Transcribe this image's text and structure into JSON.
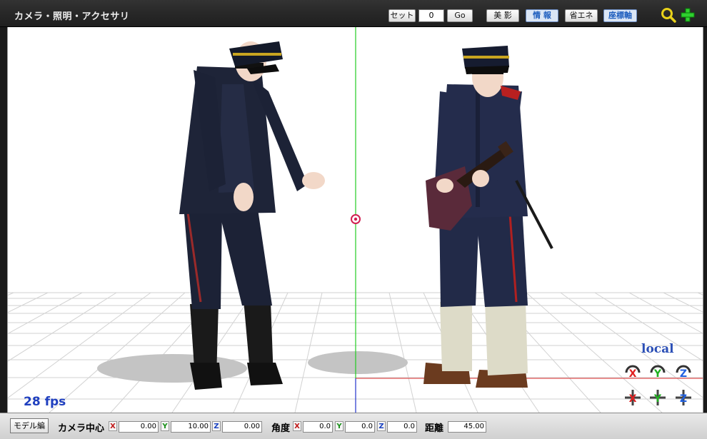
{
  "titlebar": {
    "title": "カメラ・照明・アクセサリ",
    "set_label": "セット",
    "frame_value": "0",
    "go_label": "Go",
    "bieiei_label": "美 影",
    "info_label": "情 報",
    "eco_label": "省エネ",
    "axis_label": "座標軸",
    "zoom_icon": "magnifier-icon",
    "move_icon": "green-cross-icon"
  },
  "viewport": {
    "fps": "28 fps",
    "local": "local",
    "colors": {
      "grid": "#cfcfcf",
      "y_axis": "#22cc22",
      "x_axis": "#e03030",
      "z_axis": "#2233cc"
    }
  },
  "bottombar": {
    "model_edit": "モデル編",
    "camera_center": "カメラ中心",
    "angle": "角度",
    "distance": "距離",
    "x": "X",
    "y": "Y",
    "z": "Z",
    "center_x": "0.00",
    "center_y": "10.00",
    "center_z": "0.00",
    "angle_x": "0.0",
    "angle_y": "0.0",
    "angle_z": "0.0",
    "distance_value": "45.00"
  }
}
